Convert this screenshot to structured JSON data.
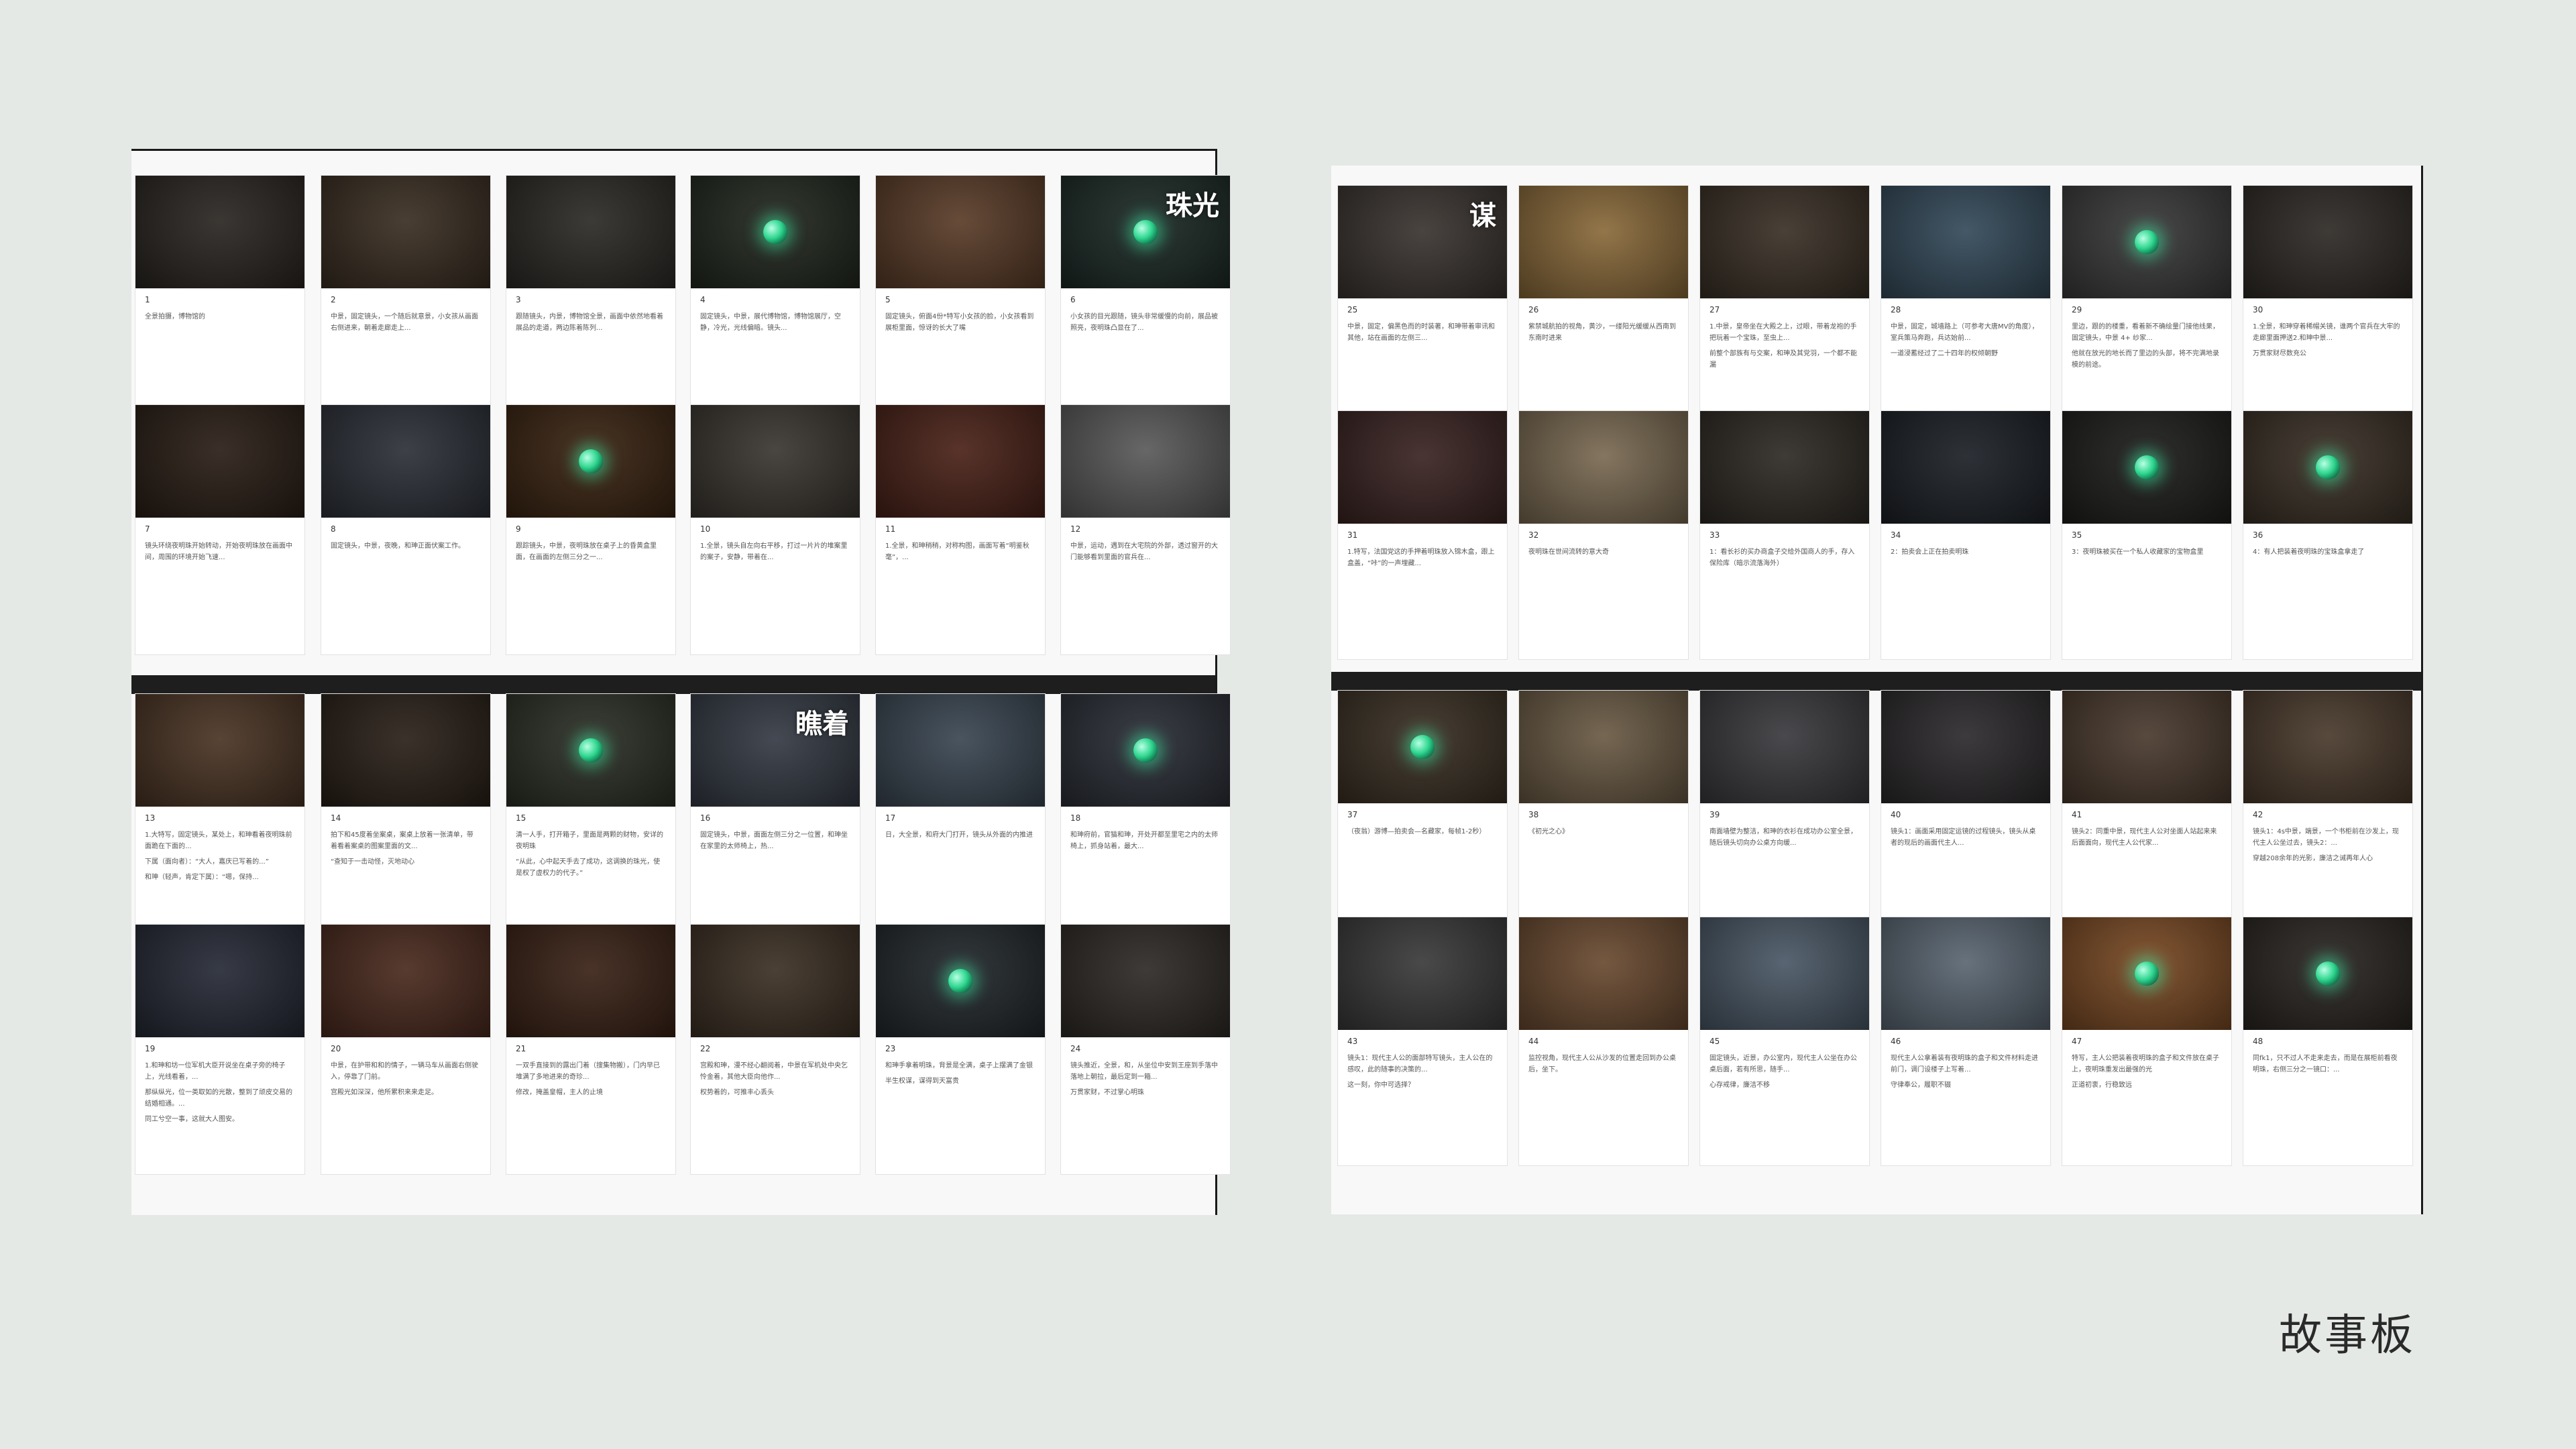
{
  "title": "故事板",
  "panels": [
    {
      "n": "1",
      "t": [
        "全景拍摄，博物馆的"
      ],
      "c": "#2a2622",
      "o": false
    },
    {
      "n": "2",
      "t": [
        "中景，固定镜头，一个随后就意景，小女孩从画面右侧进来，朝着走廊走上..."
      ],
      "c": "#3a2e22",
      "o": false
    },
    {
      "n": "3",
      "t": [
        "跟随镜头，内景，博物馆全景，画面中依然地看着展品的走道，两边陈着陈列..."
      ],
      "c": "#2c2a26",
      "o": false
    },
    {
      "n": "4",
      "t": [
        "固定镜头，中景，展代博物馆，博物馆展厅，空静，冷光，光线偏暗。镜头..."
      ],
      "c": "#22281f",
      "o": true
    },
    {
      "n": "5",
      "t": [
        "固定镜头，俯面4份*特写小女孩的脸，小女孩看到展柜里面，惊讶的长大了嘴"
      ],
      "c": "#5a3c28",
      "o": false
    },
    {
      "n": "6",
      "t": [
        "小女孩的目光跟随，镜头非常缓慢的向前，展品被照亮，夜明珠凸显在了..."
      ],
      "c": "#1c2a26",
      "o": true,
      "w": "珠光"
    },
    {
      "n": "7",
      "t": [
        "镜头环绕夜明珠开始转动，开始夜明珠放在画面中间，周围的环境开始飞速..."
      ],
      "c": "#2a1e16",
      "o": false
    },
    {
      "n": "8",
      "t": [
        "固定镜头，中景，夜晚，和珅正面伏案工作。"
      ],
      "c": "#2c3038",
      "o": false
    },
    {
      "n": "9",
      "t": [
        "跟踪镜头，中景，夜明珠放在桌子上的昏黄盒里面，在画面的左侧三分之一..."
      ],
      "c": "#3a2412",
      "o": true
    },
    {
      "n": "10",
      "t": [
        "1.全景，镜头自左向右平移，打过一片片的堆案里的案子，安静，带着在..."
      ],
      "c": "#3a3630",
      "o": false
    },
    {
      "n": "11",
      "t": [
        "1.全景，和珅稍稍，对称构图，画面写着“明鉴秋毫”，..."
      ],
      "c": "#4a2218",
      "o": false
    },
    {
      "n": "12",
      "t": [
        "中景，运动，遇到在大宅院的外部，透过窗开的大门能够看到里面的官兵在..."
      ],
      "c": "#5a5a5a",
      "o": false
    },
    {
      "n": "13",
      "t": [
        "1.大特写，固定镜头，某处上，和珅看着夜明珠前面跪在下面的...",
        "下属（面向者）：“大人，嘉庆已写着的...”",
        "和珅（轻声，肯定下属）：“嗯，保持..."
      ],
      "c": "#4a3424",
      "o": false
    },
    {
      "n": "14",
      "t": [
        "拍下和45度着坐案桌，案桌上放着一张清单，带着看着案桌的图案里面的文...",
        "“查知于一击动怪，灭地动心"
      ],
      "c": "#2a2018",
      "o": false
    },
    {
      "n": "15",
      "t": [
        "清一人手，打开箱子，里面是两颗的财物，安详的夜明珠",
        "“从此，心中起天手去了成功，这调换的珠光，使是权了虚权力的代子。”"
      ],
      "c": "#2c3026",
      "o": true
    },
    {
      "n": "16",
      "t": [
        "固定镜头，中景，面面左侧三分之一位置，和珅坐在家里的太师椅上，热..."
      ],
      "c": "#343a44",
      "o": false,
      "w": "瞧着"
    },
    {
      "n": "17",
      "t": [
        "日，大全景，和府大门打开，镜头从外面的内推进"
      ],
      "c": "#3a4652",
      "o": false
    },
    {
      "n": "18",
      "t": [
        "和珅府前，官猫和珅，开处开都至里宅之内的太师椅上，抓身站着，最大..."
      ],
      "c": "#2a2e36",
      "o": true
    },
    {
      "n": "19",
      "t": [
        "1.和珅和坊一位军机大臣开说坐在桌子旁的椅子上，光线看着，...",
        "那纵纵光，位一类取如的光散，整到了顽皮交易的结婚相通。...",
        "同工兮空一事，这就大人图安。"
      ],
      "c": "#262a36",
      "o": false
    },
    {
      "n": "20",
      "t": [
        "中景，在护带和和的情子，一辆马车从画面右侧驶入，停靠了门前。",
        "宫殿光如深深，他所累积来来走足。"
      ],
      "c": "#4a2a1e",
      "o": false
    },
    {
      "n": "21",
      "t": [
        "一双手直接到的露出门着（搜集物搬），门内早已堆满了多地进来的奇珍...",
        "修改，掩盖皇帽，主人的止境"
      ],
      "c": "#3a2216",
      "o": false
    },
    {
      "n": "22",
      "t": [
        "宫殿和珅，漫不经心翻阅着，中景在军机处中央乞怜金着，其他大臣向他作...",
        "权势着的，可推丰心丢头"
      ],
      "c": "#3c3024",
      "o": false
    },
    {
      "n": "23",
      "t": [
        "和珅手拿着明珠，背景是全满，桌子上摆满了金银",
        "半生权谋，谋得到天富贵"
      ],
      "c": "#22282c",
      "o": true
    },
    {
      "n": "24",
      "t": [
        "镜头推近，全景，和，从坐位中安到王座到手落中落地上朝拉，最后定到一箱...",
        "万贯家财，不过掌心明珠"
      ],
      "c": "#2e2a26",
      "o": false
    },
    {
      "n": "25",
      "t": [
        "中景，固定，偏黑色而的时装著，和珅带着审讯和其他，站在画面的左侧三..."
      ],
      "c": "#3a3430",
      "o": false,
      "w": "谋"
    },
    {
      "n": "26",
      "t": [
        "紫禁城航拍的视角，黄沙，一缕阳光缓缓从西南到东南时进来"
      ],
      "c": "#8a6a3a",
      "o": false
    },
    {
      "n": "27",
      "t": [
        "1.中景，皇帝坐在大殿之上，过眼，带着龙袍的手把玩着一个宝珠，至虫上...",
        "前整个部族有与交案，和珅及其党羽，一个都不能漏"
      ],
      "c": "#3a3026",
      "o": false
    },
    {
      "n": "28",
      "t": [
        "中景，固定，城墙路上（可参考大唐MV的角度），室兵策马奔跑，兵达始前...",
        "一道浸蓄经过了二十四年的权倾朝野"
      ],
      "c": "#344a5a",
      "o": false
    },
    {
      "n": "29",
      "t": [
        "里边，跟的的楼重，看着新不确绘量门接他线果，固定镜头，中景 4+ 纱家...",
        "他就在放光的地长而了里边的头部，将不完满地录模的前途。"
      ],
      "c": "#3a3a3a",
      "o": true
    },
    {
      "n": "30",
      "t": [
        "1.全景，和珅穿着稀帽关镜，谁两个官兵在大牢的走廊里面押送2.和珅中景...",
        "万贯家财尽数充公"
      ],
      "c": "#2e2a26",
      "o": false
    },
    {
      "n": "31",
      "t": [
        "1.特写，法国党这的手押着明珠放入锦木盒，跟上盒盖，“咔”的一声埋藏..."
      ],
      "c": "#3a2422",
      "o": false
    },
    {
      "n": "32",
      "t": [
        "夜明珠在世间流转的意大奇"
      ],
      "c": "#7a6a52",
      "o": false
    },
    {
      "n": "33",
      "t": [
        "1：看长衫的买办商盒子交给外国商人的手，存入保险库（暗示流落海外）"
      ],
      "c": "#2e2a24",
      "o": false
    },
    {
      "n": "34",
      "t": [
        "2：拍卖会上正在拍卖明珠"
      ],
      "c": "#1c2026",
      "o": false
    },
    {
      "n": "35",
      "t": [
        "3：夜明珠被买在一个私人收藏家的宝物盒里"
      ],
      "c": "#1e1e1c",
      "o": true
    },
    {
      "n": "36",
      "t": [
        "4：有人把装着夜明珠的宝珠盒拿走了"
      ],
      "c": "#3a3026",
      "o": true
    },
    {
      "n": "37",
      "t": [
        "（夜翁）游博—拍卖会—名藏家，每帧1-2秒）"
      ],
      "c": "#3a3024",
      "o": true
    },
    {
      "n": "38",
      "t": [
        "《初光之心》"
      ],
      "c": "#6a5a44",
      "o": false
    },
    {
      "n": "39",
      "t": [
        "南面墙壁为整洁，和珅的衣衫在成功办公室全景，随后镜头切向办公桌方向缓..."
      ],
      "c": "#3a3a3e",
      "o": false
    },
    {
      "n": "40",
      "t": [
        "镜头1：画面采用固定运镜的过程镜头，镜头从桌者的现后的画面代主人..."
      ],
      "c": "#2c2a2c",
      "o": false
    },
    {
      "n": "41",
      "t": [
        "镜头2：同重中景，现代主人公对坐面人站起来来后面面向，现代主人公代家..."
      ],
      "c": "#4a3a2e",
      "o": false
    },
    {
      "n": "42",
      "t": [
        "镜头1：4s中景，端景，一个书柜前在沙发上，现代主人公坐过去，镜头2：...",
        "穿越208余年的光影，廉洁之诫再年人心"
      ],
      "c": "#4a3a2c",
      "o": false
    },
    {
      "n": "43",
      "t": [
        "镜头1：现代主人公的面部特写镜头，主人公在的感叹，此的随事的决策的...",
        "这一刻，你中可选择？"
      ],
      "c": "#3a3a3a",
      "o": false
    },
    {
      "n": "44",
      "t": [
        "监控视角，现代主人公从沙发的位置走回到办公桌后，坐下。"
      ],
      "c": "#6a4a30",
      "o": false
    },
    {
      "n": "45",
      "t": [
        "固定镜头，近景，办公室内，现代主人公坐在办公桌后面，若有所思，随手...",
        "心存戒律，廉洁不移"
      ],
      "c": "#4a5866",
      "o": false
    },
    {
      "n": "46",
      "t": [
        "现代主人公拿着装有夜明珠的盒子和文件材料走进前门，调门设楼子上写着...",
        "守律奉公，履职不辍"
      ],
      "c": "#5a6672",
      "o": false
    },
    {
      "n": "47",
      "t": [
        "特写，主人公把装着夜明珠的盒子和文件放在桌子上，夜明珠重发出最强的光",
        "正道初衷，行稳致远"
      ],
      "c": "#7a4a24",
      "o": true
    },
    {
      "n": "48",
      "t": [
        "同fk1，只不过人不走来走去，而是在展柜前看夜明珠，右侧三分之一镜口：..."
      ],
      "c": "#2a2622",
      "o": true
    }
  ]
}
